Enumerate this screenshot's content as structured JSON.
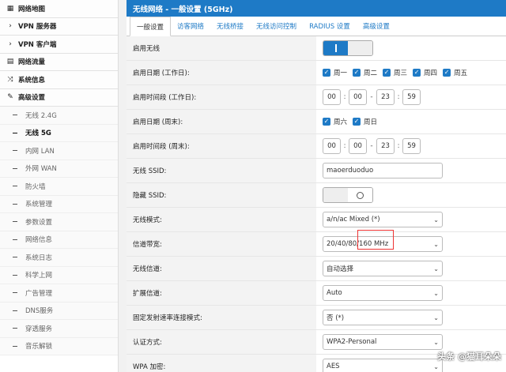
{
  "sidebar": {
    "main_items": [
      {
        "label": "网络地图",
        "icon": "map-icon"
      },
      {
        "label": "VPN 服务器",
        "icon": "chevron-right-icon"
      },
      {
        "label": "VPN 客户端",
        "icon": "chevron-right-icon"
      },
      {
        "label": "网络流量",
        "icon": "chart-icon"
      },
      {
        "label": "系统信息",
        "icon": "shuffle-icon"
      },
      {
        "label": "高级设置",
        "icon": "wrench-icon"
      }
    ],
    "sub_items": [
      {
        "label": "无线 2.4G"
      },
      {
        "label": "无线 5G"
      },
      {
        "label": "内网 LAN"
      },
      {
        "label": "外网 WAN"
      },
      {
        "label": "防火墙"
      },
      {
        "label": "系统管理"
      },
      {
        "label": "参数设置"
      },
      {
        "label": "网络信息"
      },
      {
        "label": "系统日志"
      },
      {
        "label": "科学上网"
      },
      {
        "label": "广告管理"
      },
      {
        "label": "DNS服务"
      },
      {
        "label": "穿透服务"
      },
      {
        "label": "音乐解锁"
      }
    ],
    "active_sub": "无线 5G"
  },
  "header": {
    "title": "无线网络 - 一般设置 (5GHz)"
  },
  "tabs": [
    {
      "label": "一般设置"
    },
    {
      "label": "访客网络"
    },
    {
      "label": "无线桥接"
    },
    {
      "label": "无线访问控制"
    },
    {
      "label": "RADIUS 设置"
    },
    {
      "label": "高级设置"
    }
  ],
  "form": {
    "enable_wireless": {
      "label": "启用无线",
      "state": "on"
    },
    "weekdays": {
      "label": "启用日期 (工作日):",
      "days": [
        "周一",
        "周二",
        "周三",
        "周四",
        "周五"
      ]
    },
    "weekday_time": {
      "label": "启用时间段 (工作日):",
      "start_h": "00",
      "start_m": "00",
      "end_h": "23",
      "end_m": "59"
    },
    "weekend": {
      "label": "启用日期 (周末):",
      "days": [
        "周六",
        "周日"
      ]
    },
    "weekend_time": {
      "label": "启用时间段 (周末):",
      "start_h": "00",
      "start_m": "00",
      "end_h": "23",
      "end_m": "59"
    },
    "ssid": {
      "label": "无线 SSID:",
      "value": "maoerduoduo"
    },
    "hide_ssid": {
      "label": "隐藏 SSID:",
      "state": "off"
    },
    "mode": {
      "label": "无线模式:",
      "value": "a/n/ac Mixed (*)"
    },
    "bandwidth": {
      "label": "信道带宽:",
      "value": "20/40/80/160 MHz"
    },
    "channel": {
      "label": "无线信道:",
      "value": "自动选择"
    },
    "ext_channel": {
      "label": "扩展信道:",
      "value": "Auto"
    },
    "fixed_rate": {
      "label": "固定发射速率连接模式:",
      "value": "否 (*)"
    },
    "auth": {
      "label": "认证方式:",
      "value": "WPA2-Personal"
    },
    "wpa_enc": {
      "label": "WPA 加密:",
      "value": "AES"
    }
  },
  "watermark": "头条 @猫耳朵朵"
}
